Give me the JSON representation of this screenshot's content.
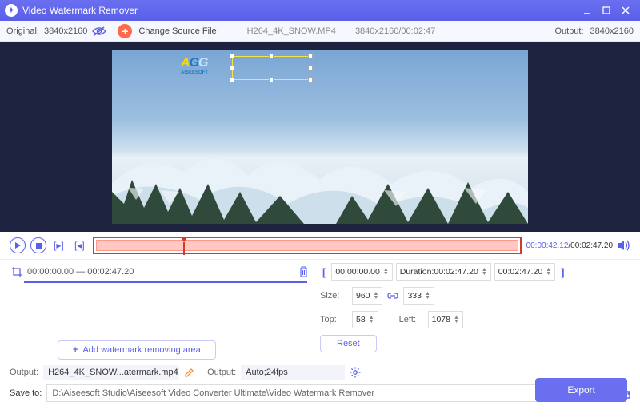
{
  "titlebar": {
    "app_name": "Video Watermark Remover"
  },
  "toolbar": {
    "original_label": "Original:",
    "original_res": "3840x2160",
    "change_source": "Change Source File",
    "filename": "H264_4K_SNOW.MP4",
    "file_info": "3840x2160/00:02:47",
    "output_label": "Output:",
    "output_res": "3840x2160"
  },
  "watermark_logo": {
    "text": "AGG",
    "subtitle": "AISEESOFT"
  },
  "playback": {
    "current_time": "00:00:42.12",
    "total_time": "00:02:47.20"
  },
  "area": {
    "start": "00:00:00.00",
    "sep": " — ",
    "end": "00:02:47.20",
    "add_label": "Add watermark removing area"
  },
  "range": {
    "start": "00:00:00.00",
    "duration_label": "Duration:",
    "duration": "00:02:47.20",
    "end": "00:02:47.20"
  },
  "size": {
    "label": "Size:",
    "w": "960",
    "h": "333"
  },
  "pos": {
    "top_label": "Top:",
    "top": "58",
    "left_label": "Left:",
    "left": "1078"
  },
  "reset_label": "Reset",
  "output": {
    "label": "Output:",
    "filename": "H264_4K_SNOW...atermark.mp4",
    "settings_label": "Output:",
    "settings_value": "Auto;24fps"
  },
  "save": {
    "label": "Save to:",
    "path": "D:\\Aiseesoft Studio\\Aiseesoft Video Converter Ultimate\\Video Watermark Remover",
    "dots": "..."
  },
  "export_label": "Export"
}
